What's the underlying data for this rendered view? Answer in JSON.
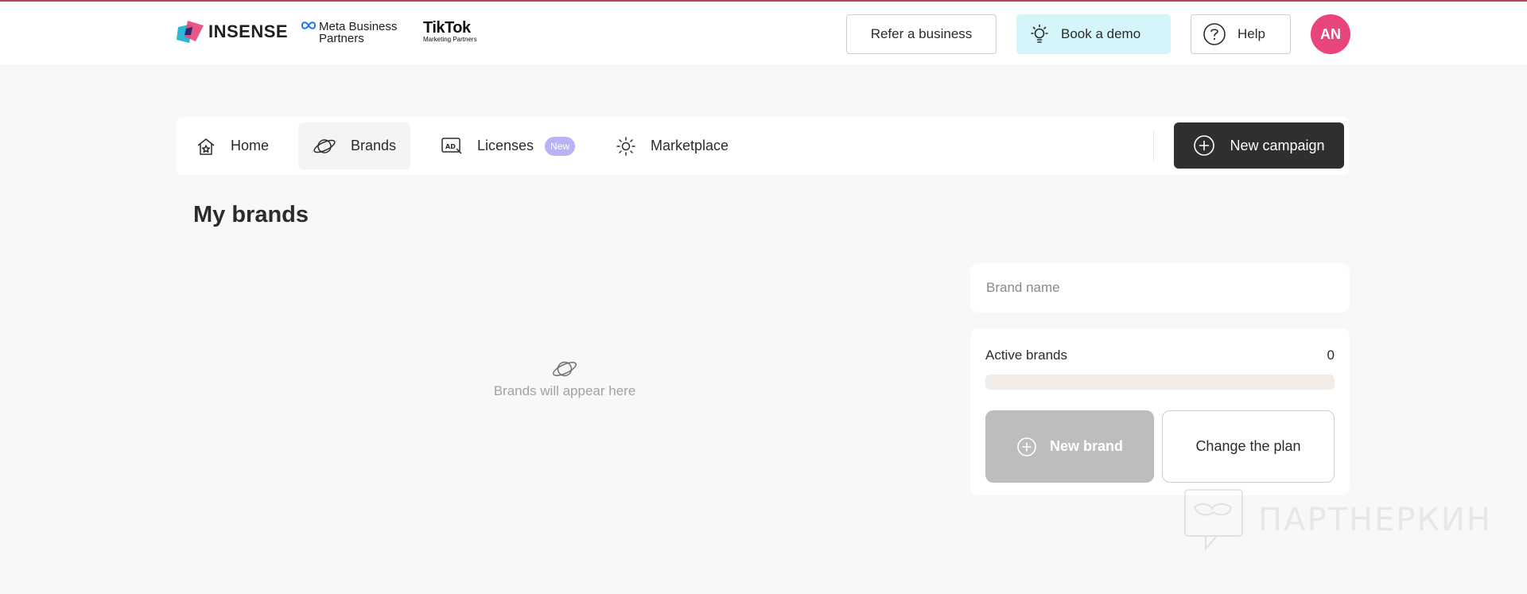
{
  "header": {
    "brand_logo": "INSENSE",
    "meta_logo": {
      "line1": "Meta Business",
      "line2": "Partners"
    },
    "tiktok_logo": {
      "name": "TikTok",
      "sub": "Marketing Partners"
    },
    "refer_label": "Refer a business",
    "demo_label": "Book a demo",
    "help_label": "Help",
    "avatar_initials": "AN"
  },
  "nav": {
    "items": [
      {
        "label": "Home",
        "icon": "home-star-icon"
      },
      {
        "label": "Brands",
        "icon": "planet-icon",
        "active": true
      },
      {
        "label": "Licenses",
        "icon": "ad-icon",
        "badge": "New"
      },
      {
        "label": "Marketplace",
        "icon": "sparkle-icon"
      }
    ],
    "new_campaign_label": "New campaign"
  },
  "main": {
    "title": "My brands",
    "empty_text": "Brands will appear here",
    "search_placeholder": "Brand name",
    "active_brands_label": "Active brands",
    "active_brands_count": "0",
    "active_brands_progress": 0,
    "new_brand_label": "New brand",
    "change_plan_label": "Change the plan"
  },
  "watermark": {
    "text": "ПАРТНЕРКИН"
  },
  "colors": {
    "accent_dark": "#2f2f2f",
    "avatar_bg": "#e8457a",
    "demo_bg": "#d4f6fb",
    "badge_new": "#b8b4f4",
    "page_bg": "#f8f8f8"
  }
}
